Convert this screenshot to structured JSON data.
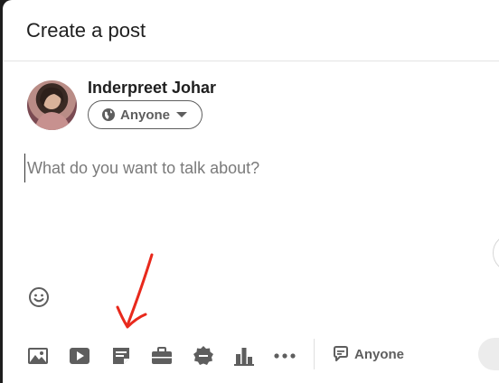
{
  "dialog": {
    "title": "Create a post"
  },
  "author": {
    "name": "Inderpreet Johar",
    "audience_label": "Anyone"
  },
  "composer": {
    "placeholder": "What do you want to talk about?",
    "value": ""
  },
  "toolbar": {
    "items": [
      {
        "name": "add-photo",
        "icon": "image-icon"
      },
      {
        "name": "add-video",
        "icon": "video-play-icon"
      },
      {
        "name": "add-document",
        "icon": "document-icon"
      },
      {
        "name": "share-job",
        "icon": "briefcase-icon"
      },
      {
        "name": "celebrate",
        "icon": "badge-icon"
      },
      {
        "name": "create-poll",
        "icon": "bar-chart-icon"
      },
      {
        "name": "more",
        "icon": "more-horizontal-icon"
      }
    ],
    "comment_control_label": "Anyone"
  },
  "annotation": {
    "arrow_color": "#e8291c"
  },
  "colors": {
    "icon_gray": "#5e5e5e",
    "text_dark": "#1f1f1f"
  }
}
